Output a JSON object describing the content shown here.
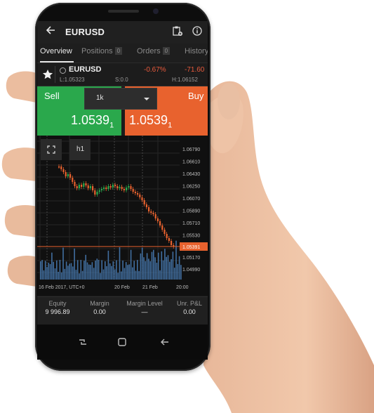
{
  "header": {
    "title": "EURUSD",
    "back_icon": "arrow-left-icon",
    "clipboard_icon": "clipboard-plus-icon",
    "info_icon": "info-icon"
  },
  "tabs": [
    {
      "label": "Overview",
      "count": ""
    },
    {
      "label": "Positions",
      "count": "0"
    },
    {
      "label": "Orders",
      "count": "0"
    },
    {
      "label": "History",
      "count": ""
    }
  ],
  "instrument": {
    "symbol": "EURUSD",
    "change_pct": "-0.67%",
    "change_pips": "-71.60",
    "low": "L:1.05323",
    "spread": "S:0.0",
    "high": "H:1.06152"
  },
  "trade": {
    "sell_label": "Sell",
    "buy_label": "Buy",
    "quantity": "1k",
    "sell_price_main": "1.0539",
    "sell_price_pip": "1",
    "buy_price_main": "1.0539",
    "buy_price_pip": "1",
    "sell_color": "#2aa84c",
    "buy_color": "#e8622e"
  },
  "chart": {
    "timeframe": "h1",
    "price_labels": [
      "1.06790",
      "1.06610",
      "1.06430",
      "1.06250",
      "1.06070",
      "1.05890",
      "1.05710",
      "1.05530",
      "1.05390",
      "1.05170",
      "1.04990"
    ],
    "time_labels": [
      "16 Feb 2017, UTC+0",
      "20 Feb",
      "21 Feb",
      "20:00"
    ],
    "current_price_label": "1.05391"
  },
  "summary": [
    {
      "label": "Equity",
      "value": "9 996.89"
    },
    {
      "label": "Margin",
      "value": "0.00"
    },
    {
      "label": "Margin Level",
      "value": "—"
    },
    {
      "label": "Unr. P&L",
      "value": "0.00"
    }
  ]
}
